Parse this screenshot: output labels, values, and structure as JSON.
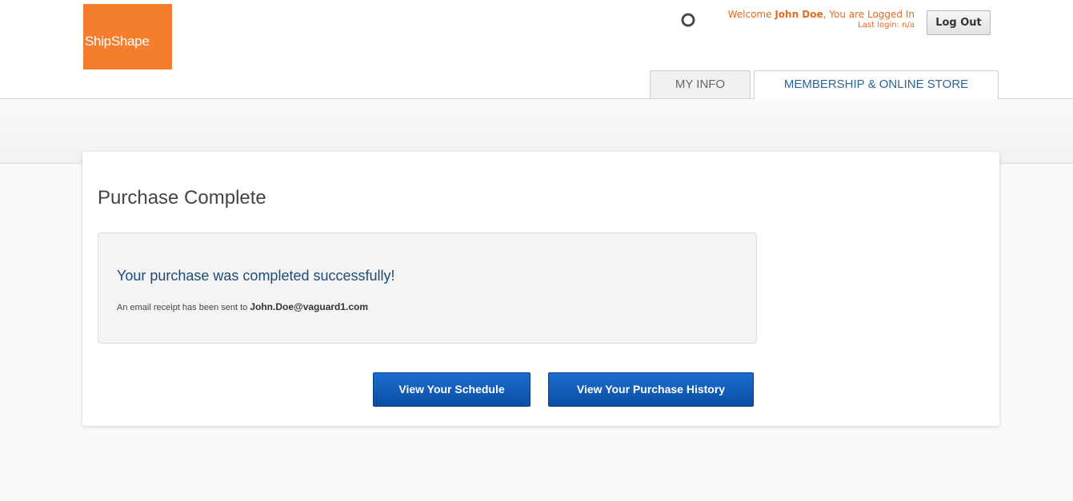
{
  "header": {
    "logo_text": "ShipShape",
    "welcome_prefix": "Welcome ",
    "user_name": "John Doe",
    "welcome_suffix": ", You are Logged In",
    "last_login": "Last login: n/a",
    "logout_label": "Log Out",
    "user_icon": "user-circle-icon"
  },
  "tabs": [
    {
      "label": "MY INFO",
      "active": false
    },
    {
      "label": "MEMBERSHIP & ONLINE STORE",
      "active": true
    }
  ],
  "main": {
    "title": "Purchase Complete",
    "message_heading": "Your purchase was completed successfully!",
    "receipt_prefix": "An email receipt has been sent to ",
    "receipt_email": "John.Doe@vaguard1.com",
    "buttons": {
      "schedule_label": "View Your Schedule",
      "history_label": "View Your Purchase History"
    }
  },
  "colors": {
    "brand_orange": "#f47e2e",
    "welcome_text": "#e8691f",
    "primary_button": "#0b5cc1",
    "tab_active_text": "#2b6496",
    "heading_blue": "#1e4c78"
  }
}
